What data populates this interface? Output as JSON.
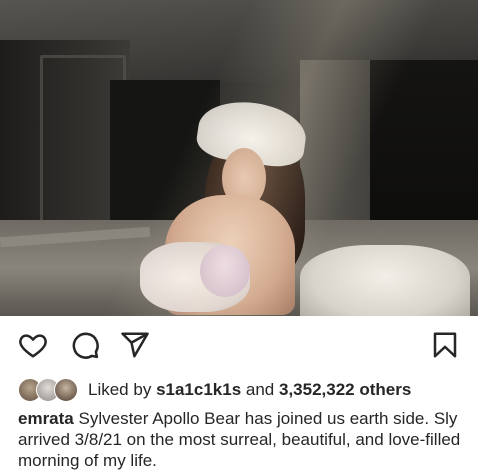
{
  "post": {
    "image_alt_icon": "post-photo",
    "likes": {
      "prefix": "Liked by",
      "user": "s1a1c1k1s",
      "joiner": "and",
      "count": "3,352,322 others"
    },
    "caption": {
      "username": "emrata",
      "text": "Sylvester Apollo Bear has joined us earth side. Sly arrived 3/8/21 on the most surreal, beautiful, and love-filled morning of my life."
    }
  },
  "actions": {
    "like_icon": "heart-icon",
    "comment_icon": "comment-icon",
    "share_icon": "send-icon",
    "save_icon": "bookmark-icon"
  },
  "colors": {
    "text": "#262626",
    "background": "#ffffff"
  }
}
